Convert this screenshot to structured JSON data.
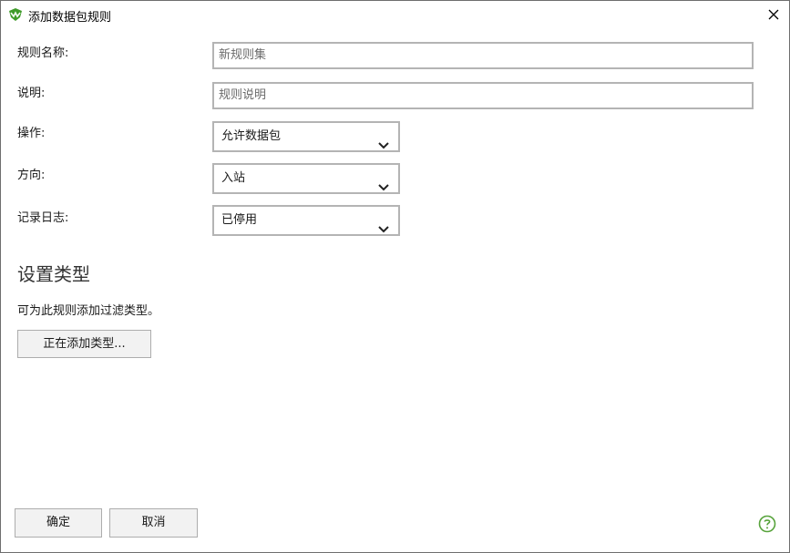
{
  "window": {
    "title": "添加数据包规则",
    "app_icon": "shield-icon",
    "close_icon": "close-icon"
  },
  "form": {
    "rule_name_label": "规则名称:",
    "rule_name_placeholder": "新规则集",
    "description_label": "说明:",
    "description_placeholder": "规则说明",
    "action_label": "操作:",
    "action_value": "允许数据包",
    "direction_label": "方向:",
    "direction_value": "入站",
    "logging_label": "记录日志:",
    "logging_value": "已停用"
  },
  "types": {
    "title": "设置类型",
    "description": "可为此规则添加过滤类型。",
    "add_button": "正在添加类型..."
  },
  "footer": {
    "ok_label": "确定",
    "cancel_label": "取消",
    "help_icon": "help-icon"
  },
  "colors": {
    "border": "#b4b4b4",
    "help": "#57a33b",
    "icon_green": "#3f9b2a"
  }
}
